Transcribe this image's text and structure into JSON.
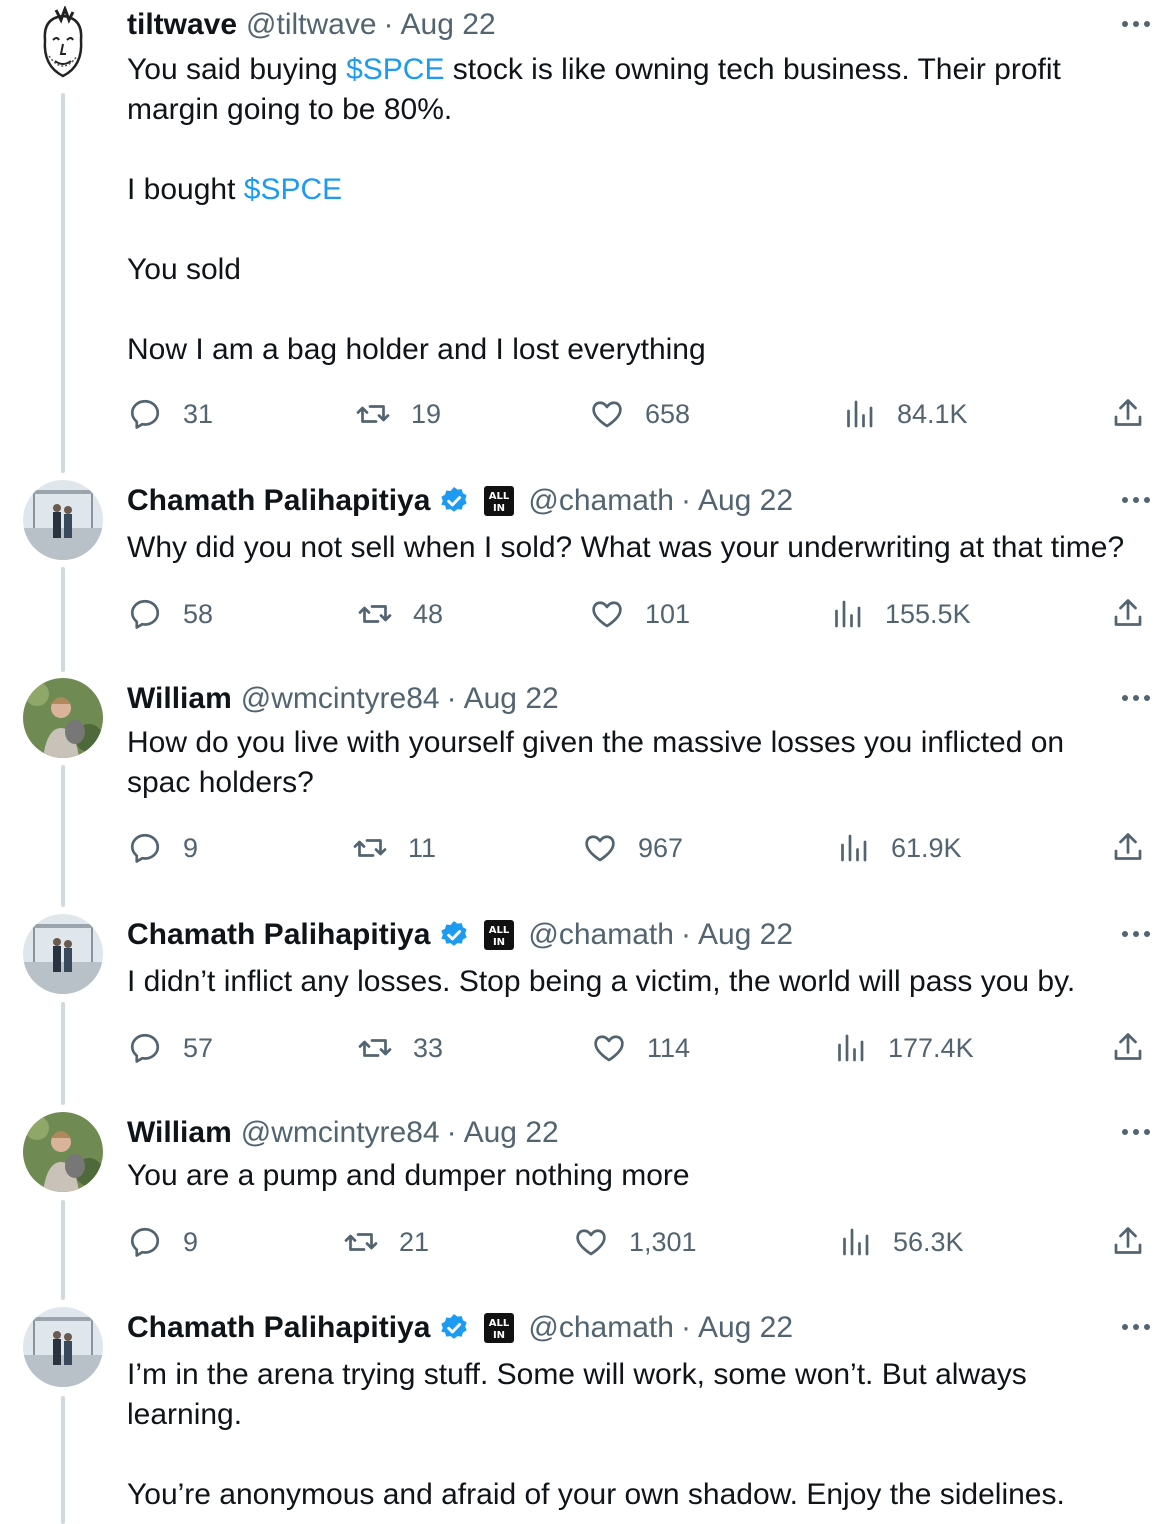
{
  "tweets": [
    {
      "name": "tiltwave",
      "handle": "@tiltwave",
      "date": "Aug 22",
      "verified": false,
      "text_parts": [
        {
          "t": "You said buying "
        },
        {
          "t": "$SPCE",
          "cash": true
        },
        {
          "t": " stock is like owning tech business. Their profit\nmargin going to be 80%.\n\nI bought "
        },
        {
          "t": "$SPCE",
          "cash": true
        },
        {
          "t": "\n\nYou sold\n\nNow I am a bag holder and I lost everything"
        }
      ],
      "replies": "31",
      "retweets": "19",
      "likes": "658",
      "views": "84.1K"
    },
    {
      "name": "Chamath Palihapitiya",
      "handle": "@chamath",
      "date": "Aug 22",
      "verified": true,
      "text_parts": [
        {
          "t": "Why did you not sell when I sold? What was your underwriting at that time?"
        }
      ],
      "replies": "58",
      "retweets": "48",
      "likes": "101",
      "views": "155.5K"
    },
    {
      "name": "William",
      "handle": "@wmcintyre84",
      "date": "Aug 22",
      "verified": false,
      "text_parts": [
        {
          "t": "How do you live with yourself given the massive losses you inflicted on\nspac holders?"
        }
      ],
      "replies": "9",
      "retweets": "11",
      "likes": "967",
      "views": "61.9K"
    },
    {
      "name": "Chamath Palihapitiya",
      "handle": "@chamath",
      "date": "Aug 22",
      "verified": true,
      "text_parts": [
        {
          "t": "I didn’t inflict any losses. Stop being a victim, the world will pass you by."
        }
      ],
      "replies": "57",
      "retweets": "33",
      "likes": "114",
      "views": "177.4K"
    },
    {
      "name": "William",
      "handle": "@wmcintyre84",
      "date": "Aug 22",
      "verified": false,
      "text_parts": [
        {
          "t": "You are a pump and dumper nothing more"
        }
      ],
      "replies": "9",
      "retweets": "21",
      "likes": "1,301",
      "views": "56.3K"
    },
    {
      "name": "Chamath Palihapitiya",
      "handle": "@chamath",
      "date": "Aug 22",
      "verified": true,
      "text_parts": [
        {
          "t": "I’m in the arena trying stuff. Some will work, some won’t. But always\nlearning.\n\nYou’re anonymous and afraid of your own shadow. Enjoy the sidelines."
        }
      ],
      "replies": "",
      "retweets": "",
      "likes": "",
      "views": ""
    }
  ],
  "affiliation_badge_text": "ALL IN",
  "colors": {
    "accent": "#1d9bf0",
    "secondary_text": "#536471",
    "thread_line": "#cfd9de"
  }
}
